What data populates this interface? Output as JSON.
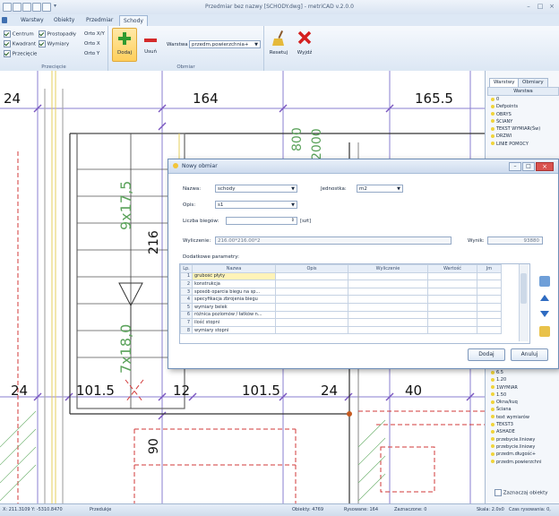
{
  "window": {
    "title": "Przedmiar bez nazwy [SCHODY.dwg] - metriCAD v.2.0.0"
  },
  "tabs": [
    "Warstwy",
    "Obiekty",
    "Przedmiar",
    "Schody"
  ],
  "ribbon": {
    "przeciecie_group": {
      "label": "Przecięcie",
      "options": [
        {
          "label": "Centrum",
          "checked": true
        },
        {
          "label": "Prostopadły",
          "checked": true
        },
        {
          "label": "Kwadrant",
          "checked": true
        },
        {
          "label": "Wymiary",
          "checked": true
        },
        {
          "label": "Przecięcie",
          "checked": true
        }
      ],
      "ortho": [
        "Orto X/Y",
        "Orto X",
        "Orto Y"
      ]
    },
    "obmiar_group": {
      "label": "Obmiar",
      "add_label": "Dodaj",
      "remove_label": "Usuń",
      "layer_label": "Warstwa",
      "layer_value": "przedm.powierzchnia+",
      "reset_label": "Resetuj",
      "exit_label": "Wyjdź"
    }
  },
  "drawing": {
    "dims_top": [
      "24",
      "164",
      "165.5"
    ],
    "dims_bottom": [
      "24",
      "101.5",
      "12",
      "101.5",
      "24",
      "40"
    ],
    "green_labels": [
      "9x17,5",
      "7x18,0",
      "800",
      "2000"
    ],
    "vertical_dims": [
      "216",
      "90"
    ]
  },
  "right_panel": {
    "tabs": [
      "Warstwy",
      "Obmiary"
    ],
    "header": "Warstwa",
    "top_items": [
      "0",
      "Defpoints",
      "OBRYS",
      "ŚCIANY",
      "TEKST WYMIAR(Św)",
      "DRZWI",
      "LINIE POMOCY"
    ],
    "bottom_items": [
      "6.5",
      "1.20",
      "1WYMIAR",
      "1.50",
      "Okna/kuq",
      "Ściana",
      "text wymiarów",
      "TEKST3",
      "ASHADE",
      "przebycie.liniowy",
      "przebycie.liniowy",
      "przedm.długość+",
      "przedm.powierzchni"
    ],
    "checkbox_label": "Zaznaczaj obiekty"
  },
  "status_bar": {
    "coords": "X: 211.3109  Y: -5310.8470",
    "mode": "Przedukje",
    "objects": "Obiekty: 4769",
    "drawn": "Rysowane: 164",
    "selected": "Zaznaczone: 0",
    "scale": "Skala: 2.0x0",
    "time": "Czas rysowania: 0,"
  },
  "dialog": {
    "title": "Nowy obmiar",
    "name_label": "Nazwa:",
    "name_value": "schody",
    "unit_label": "Jednostka:",
    "unit_value": "m2",
    "desc_label": "Opis:",
    "desc_value": "s1",
    "runs_label": "Liczba biegów:",
    "runs_value": "",
    "runs_unit": "[szt]",
    "formula_label": "Wyliczenie:",
    "formula_value": "216.00*216.00*2",
    "result_label": "Wynik:",
    "result_value": "93880",
    "params_label": "Dodatkowe parametry:",
    "columns": [
      "Lp.",
      "Nazwa",
      "Opis",
      "Wyliczenie",
      "Wartość",
      "Jm"
    ],
    "rows": [
      {
        "lp": "1",
        "name": "grubość płyty"
      },
      {
        "lp": "2",
        "name": "konstrukcja"
      },
      {
        "lp": "3",
        "name": "sposób oparcia biegu na sp..."
      },
      {
        "lp": "4",
        "name": "specyfikacja zbrojenia biegu"
      },
      {
        "lp": "5",
        "name": "wymiary belek"
      },
      {
        "lp": "6",
        "name": "różnica poziomów / łatków n..."
      },
      {
        "lp": "7",
        "name": "ilość stopni"
      },
      {
        "lp": "8",
        "name": "wymiary stopni"
      }
    ],
    "add_button": "Dodaj",
    "cancel_button": "Anuluj"
  },
  "colors": {
    "purple_grid": "#8a7fd0",
    "green_text": "#5aa25a",
    "red_dash": "#d23a3a",
    "accent_blue": "#2e6bc1"
  }
}
